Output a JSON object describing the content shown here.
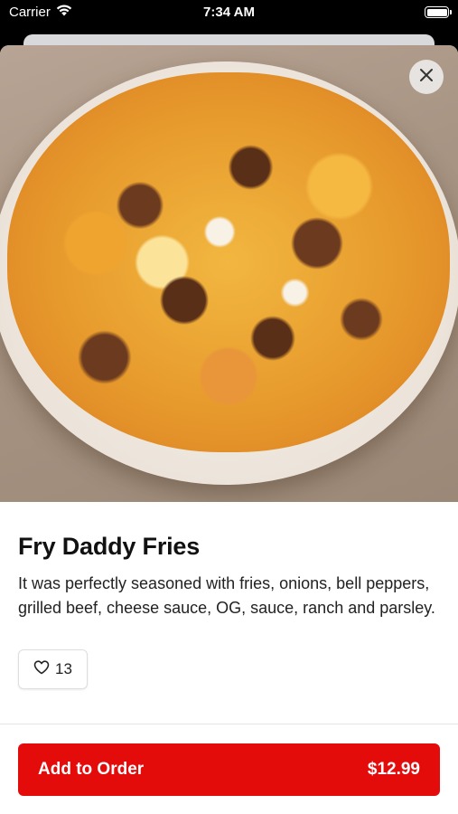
{
  "status_bar": {
    "carrier": "Carrier",
    "time": "7:34 AM"
  },
  "item": {
    "title": "Fry Daddy Fries",
    "description": "It was perfectly seasoned with fries, onions, bell peppers, grilled beef, cheese sauce, OG, sauce, ranch and parsley.",
    "likes": "13"
  },
  "order": {
    "label": "Add to Order",
    "price": "$12.99"
  },
  "colors": {
    "accent": "#e40b0b"
  },
  "icons": [
    "wifi-icon",
    "battery-icon",
    "close-icon",
    "heart-icon"
  ]
}
